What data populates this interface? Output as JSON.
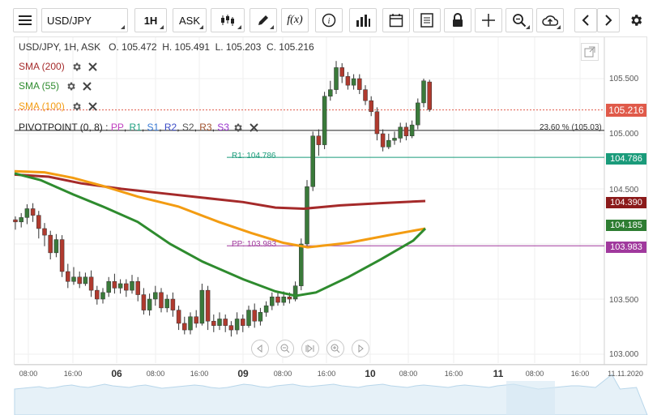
{
  "toolbar": {
    "symbol": "USD/JPY",
    "timeframe": "1H",
    "price_type": "ASK",
    "fx_label": "f(x)"
  },
  "chart": {
    "ohlc_text": "USD/JPY, 1H, ASK   O. 105.472  H. 105.491  L. 105.203  C. 105.216",
    "indicators": [
      {
        "label": "SMA (200)",
        "color": "#a52a2a"
      },
      {
        "label": "SMA (55)",
        "color": "#2e8b2e"
      },
      {
        "label": "SMA (100)",
        "color": "#f39c12"
      }
    ],
    "pivot": {
      "prefix": "PIVOTPOINT (0, 8) : ",
      "items": [
        {
          "label": "PP",
          "color": "#c040c0"
        },
        {
          "label": "R1",
          "color": "#20a080"
        },
        {
          "label": "S1",
          "color": "#3a7bd5"
        },
        {
          "label": "R2",
          "color": "#3a4bc5"
        },
        {
          "label": "S2",
          "color": "#555555"
        },
        {
          "label": "R3",
          "color": "#a0522d"
        },
        {
          "label": "S3",
          "color": "#9932cc"
        }
      ]
    },
    "fib_label": "23.60 % (105.03)",
    "r1_label": "R1: 104.786",
    "pp_label": "PP: 103.983",
    "y_axis": [
      "105.500",
      "105.000",
      "104.500",
      "104.000",
      "103.500",
      "103.000"
    ],
    "price_tags": {
      "current": "105.216",
      "r1": "104.786",
      "sma200": "104.390",
      "sma55": "104.185",
      "pp": "103.983"
    },
    "x_axis": [
      {
        "label": "08:00",
        "bold": false
      },
      {
        "label": "16:00",
        "bold": false
      },
      {
        "label": "06",
        "bold": true
      },
      {
        "label": "08:00",
        "bold": false
      },
      {
        "label": "16:00",
        "bold": false
      },
      {
        "label": "09",
        "bold": true
      },
      {
        "label": "08:00",
        "bold": false
      },
      {
        "label": "16:00",
        "bold": false
      },
      {
        "label": "10",
        "bold": true
      },
      {
        "label": "08:00",
        "bold": false
      },
      {
        "label": "16:00",
        "bold": false
      },
      {
        "label": "11",
        "bold": true
      },
      {
        "label": "08:00",
        "bold": false
      },
      {
        "label": "16:00",
        "bold": false
      },
      {
        "label": "11.11.2020",
        "bold": false
      }
    ],
    "colors": {
      "up": "#3a7a3a",
      "down": "#b03a2e",
      "sma200": "#a52a2a",
      "sma55": "#2e8b2e",
      "sma100": "#f39c12",
      "current_tag": "#e05a4a",
      "r1_tag": "#1a9b7a",
      "sma200_tag": "#8b1a1a",
      "sma55_tag": "#2e7d32",
      "pp_tag": "#a0399d"
    }
  }
}
